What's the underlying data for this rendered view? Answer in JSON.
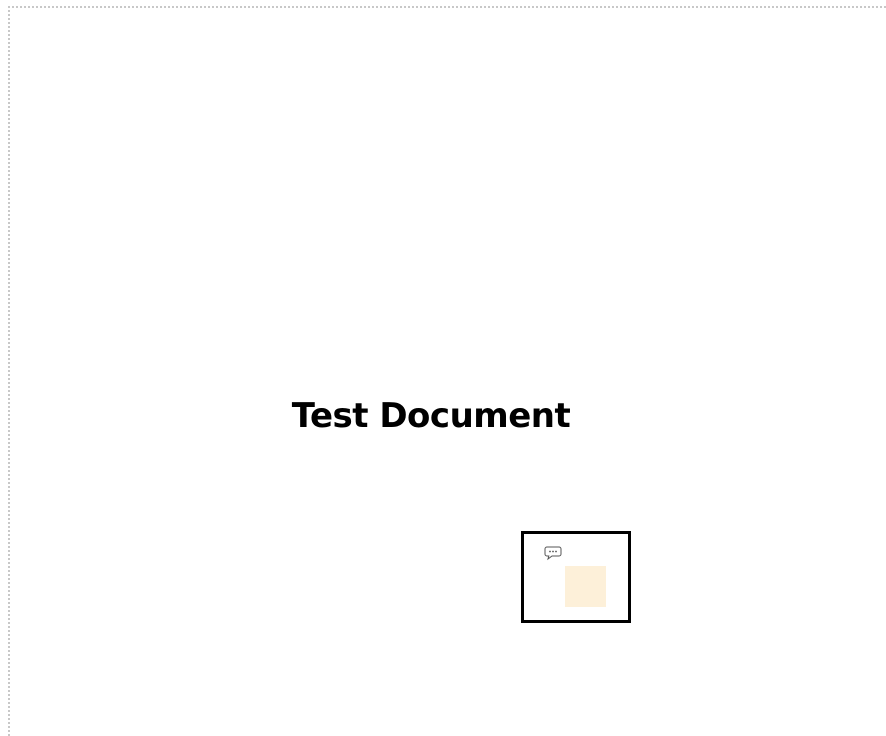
{
  "document": {
    "title": "Test Document"
  },
  "annotation": {
    "icon": "comment-icon",
    "note_color": "#fdf0d9",
    "border_color": "#000000"
  },
  "colors": {
    "page_border": "#c8c8c8",
    "background": "#ffffff",
    "text": "#000000"
  }
}
